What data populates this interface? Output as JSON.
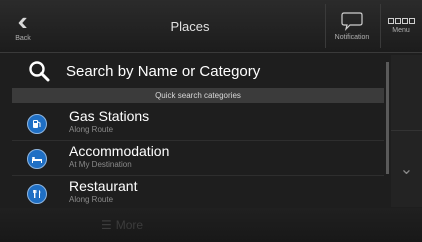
{
  "header": {
    "back_label": "Back",
    "title": "Places",
    "notification_label": "Notification",
    "menu_label": "Menu"
  },
  "search": {
    "label": "Search by Name or Category",
    "icon": "search-icon"
  },
  "categories": {
    "header": "Quick search categories",
    "items": [
      {
        "title": "Gas Stations",
        "subtitle": "Along Route",
        "icon": "gas-station-icon"
      },
      {
        "title": "Accommodation",
        "subtitle": "At My Destination",
        "icon": "bed-icon"
      },
      {
        "title": "Restaurant",
        "subtitle": "Along Route",
        "icon": "fork-knife-icon"
      }
    ]
  },
  "footer": {
    "more_label": "More"
  },
  "colors": {
    "accent_blue": "#1f6fc4",
    "background": "#1e1e1e"
  }
}
